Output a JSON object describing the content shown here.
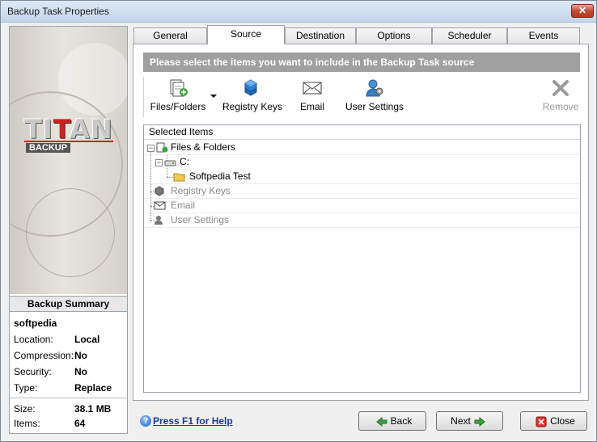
{
  "window": {
    "title": "Backup Task Properties"
  },
  "banner": {
    "logo_text_a": "TI",
    "logo_text_b": "T",
    "logo_text_c": "A",
    "logo_text_d": "N",
    "logo_sub": "BACKUP"
  },
  "summary": {
    "heading": "Backup Summary",
    "name": "softpedia",
    "rows": [
      {
        "key": "Location:",
        "value": "Local"
      },
      {
        "key": "Compression:",
        "value": "No"
      },
      {
        "key": "Security:",
        "value": "No"
      },
      {
        "key": "Type:",
        "value": "Replace"
      }
    ],
    "stats": [
      {
        "key": "Size:",
        "value": "38.1 MB"
      },
      {
        "key": "Items:",
        "value": "64"
      }
    ]
  },
  "tabs": [
    "General",
    "Source",
    "Destination",
    "Options",
    "Scheduler",
    "Events"
  ],
  "active_tab": "Source",
  "source": {
    "info": "Please select the items you want to include in the Backup Task source",
    "toolbar": {
      "files_folders": "Files/Folders",
      "registry_keys": "Registry Keys",
      "email": "Email",
      "user_settings": "User Settings",
      "remove": "Remove"
    },
    "tree": {
      "header": "Selected Items",
      "files_folders": "Files & Folders",
      "drive": "C:",
      "folder": "Softpedia Test",
      "registry_keys": "Registry Keys",
      "email": "Email",
      "user_settings": "User Settings"
    }
  },
  "footer": {
    "help": "Press F1 for Help",
    "back": "Back",
    "next": "Next",
    "close": "Close"
  },
  "colors": {
    "info_bar": "#a0a0a0",
    "accent_red": "#cc2222",
    "link": "#1a3a9a"
  }
}
